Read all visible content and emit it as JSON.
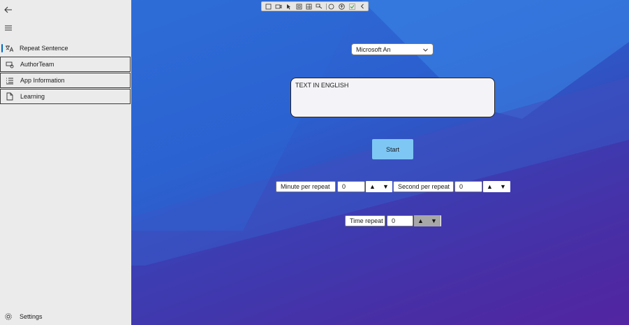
{
  "sidebar": {
    "back_icon": "back-arrow-icon",
    "menu_icon": "hamburger-icon",
    "items": [
      {
        "label": "Repeat Sentence",
        "icon": "translate-icon"
      },
      {
        "label": "AuthorTeam",
        "icon": "team-icon"
      },
      {
        "label": "App Information",
        "icon": "list-icon"
      },
      {
        "label": "Learning",
        "icon": "document-icon"
      }
    ],
    "settings_label": "Settings",
    "accent": "#0067c0"
  },
  "toolbar": {
    "buttons": [
      "select-icon",
      "camera-icon",
      "pointer-icon",
      "frame-icon",
      "layout-icon",
      "tracking-icon",
      "binding-icon",
      "accessibility-icon",
      "check-icon",
      "collapse-icon"
    ]
  },
  "main": {
    "voice_select": {
      "value": "Microsoft An"
    },
    "text_input": {
      "value": "TEXT IN ENGLISH"
    },
    "start_label": "Start",
    "minute": {
      "label": "Minute per repeat",
      "value": "0"
    },
    "second": {
      "label": "Second per repeat",
      "value": "0"
    },
    "time_repeat": {
      "label": "Time repeat",
      "value": "0"
    },
    "spin_up": "▲",
    "spin_down": "▼",
    "start_color": "#7ec7f5"
  }
}
